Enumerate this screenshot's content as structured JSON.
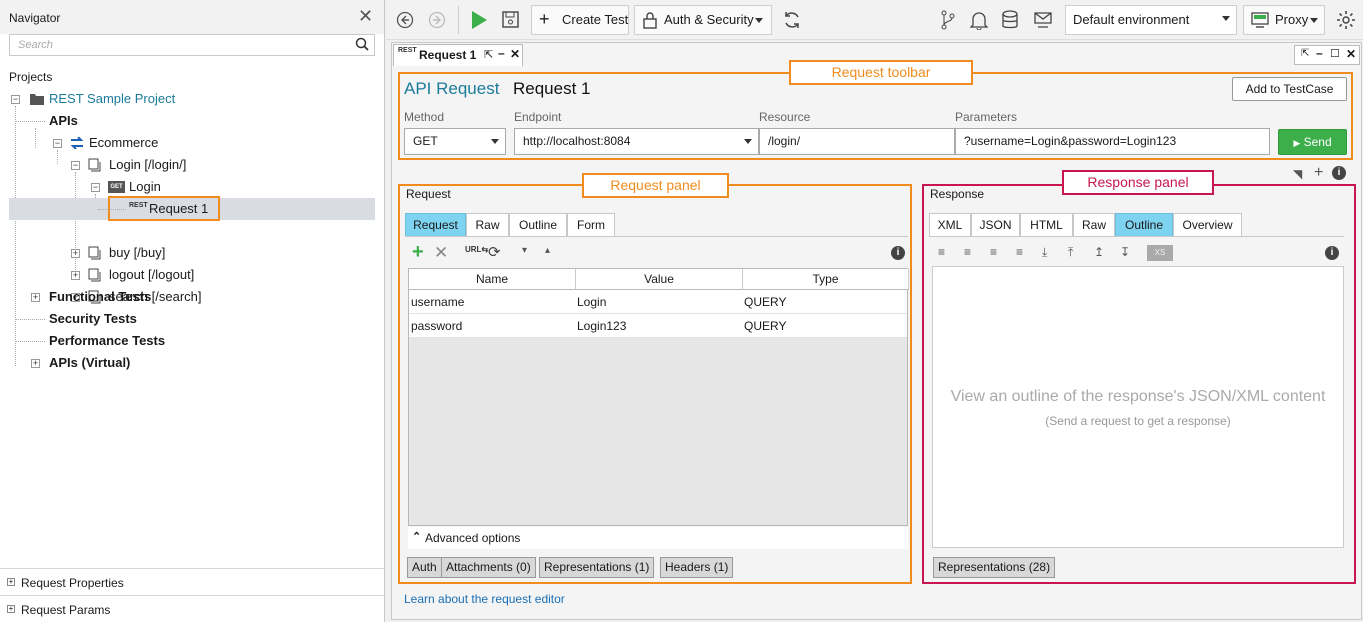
{
  "navigator": {
    "title": "Navigator",
    "search_placeholder": "Search",
    "projects_label": "Projects",
    "tree": {
      "project": "REST Sample Project",
      "apis": "APIs",
      "ecommerce": "Ecommerce",
      "login_resource": "Login [/login/]",
      "login_method": "Login",
      "request1": "Request 1",
      "buy": "buy [/buy]",
      "logout": "logout [/logout]",
      "search": "search [/search]",
      "functional_tests": "Functional Tests",
      "security_tests": "Security Tests",
      "performance_tests": "Performance Tests",
      "apis_virtual": "APIs (Virtual)"
    },
    "bottom": {
      "request_properties": "Request Properties",
      "request_params": "Request Params"
    },
    "get_badge": "GET",
    "rest_badge": "REST"
  },
  "toolbar": {
    "create_test": "Create Test",
    "auth_security": "Auth & Security",
    "environment": "Default environment",
    "proxy": "Proxy"
  },
  "editor": {
    "tab_title": "Request 1",
    "api_request_label": "API Request",
    "request_name": "Request 1",
    "add_to_testcase": "Add to TestCase",
    "fields": {
      "method_label": "Method",
      "method": "GET",
      "endpoint_label": "Endpoint",
      "endpoint": "http://localhost:8084",
      "resource_label": "Resource",
      "resource": "/login/",
      "parameters_label": "Parameters",
      "parameters": "?username=Login&password=Login123"
    },
    "send": "Send",
    "callouts": {
      "toolbar": "Request toolbar",
      "request_panel": "Request panel",
      "response_panel": "Response panel"
    },
    "request": {
      "title": "Request",
      "tabs": [
        "Request",
        "Raw",
        "Outline",
        "Form"
      ],
      "columns": [
        "Name",
        "Value",
        "Type"
      ],
      "rows": [
        {
          "name": "username",
          "value": "Login",
          "type": "QUERY"
        },
        {
          "name": "password",
          "value": "Login123",
          "type": "QUERY"
        }
      ],
      "advanced_options": "Advanced options",
      "bottom_tabs": [
        "Auth",
        "Attachments (0)",
        "Representations (1)",
        "Headers (1)"
      ]
    },
    "response": {
      "title": "Response",
      "tabs": [
        "XML",
        "JSON",
        "HTML",
        "Raw",
        "Outline",
        "Overview"
      ],
      "empty_main": "View an outline of the response's JSON/XML content",
      "empty_sub": "(Send a request to get a response)",
      "bottom_tabs": [
        "Representations (28)"
      ]
    },
    "learn_link": "Learn about the request editor"
  },
  "colors": {
    "accent_orange": "#f08c1e",
    "accent_red": "#c8174e",
    "link_teal": "#1a7b9a",
    "send_green": "#3cae4a",
    "active_tab": "#7dd3f0"
  }
}
